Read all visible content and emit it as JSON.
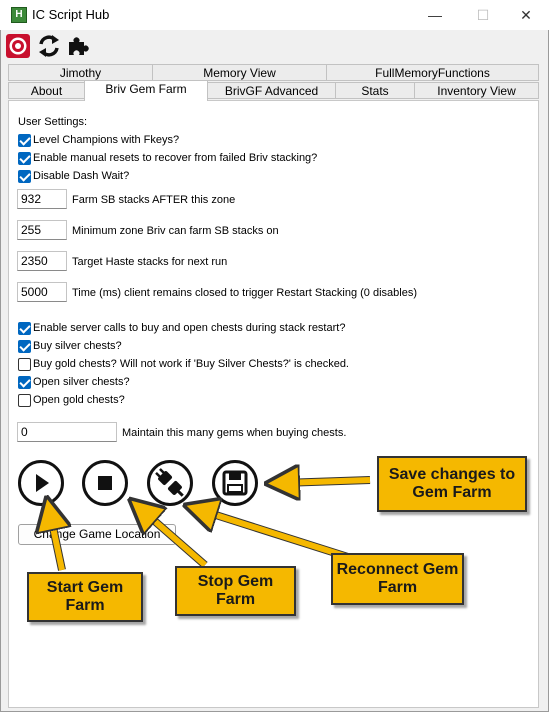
{
  "window": {
    "title": "IC Script Hub",
    "app_icon_letter": "H",
    "minimize_glyph": "—",
    "maximize_glyph": "☐",
    "close_glyph": "✕"
  },
  "toolbar": {
    "icons": [
      "record-icon",
      "refresh-icon",
      "puzzle-icon"
    ]
  },
  "tabs": {
    "row1": [
      "Jimothy",
      "Memory View",
      "FullMemoryFunctions"
    ],
    "row2": [
      "About",
      "Briv Gem Farm",
      "BrivGF Advanced",
      "Stats",
      "Inventory View"
    ],
    "active": "Briv Gem Farm"
  },
  "settings": {
    "header": "User Settings:",
    "level_champions": {
      "label": "Level Champions with Fkeys?",
      "checked": true
    },
    "manual_resets": {
      "label": "Enable manual resets to recover from failed Briv stacking?",
      "checked": true
    },
    "disable_dash": {
      "label": "Disable Dash Wait?",
      "checked": true
    },
    "farm_sb_zone": {
      "value": "932",
      "label": "Farm SB stacks AFTER this zone"
    },
    "min_zone": {
      "value": "255",
      "label": "Minimum zone Briv can farm SB stacks on"
    },
    "target_haste": {
      "value": "2350",
      "label": "Target Haste stacks for next run"
    },
    "restart_time": {
      "value": "5000",
      "label": "Time (ms) client remains closed to trigger Restart Stacking (0 disables)"
    },
    "server_calls": {
      "label": "Enable server calls to buy and open chests during stack restart?",
      "checked": true
    },
    "buy_silver": {
      "label": "Buy silver chests?",
      "checked": true
    },
    "buy_gold": {
      "label": "Buy gold chests? Will not work if 'Buy Silver Chests?' is checked.",
      "checked": false
    },
    "open_silver": {
      "label": "Open silver chests?",
      "checked": true
    },
    "open_gold": {
      "label": "Open gold chests?",
      "checked": false
    },
    "maintain_gems": {
      "value": "0",
      "label": "Maintain this many gems when buying chests."
    }
  },
  "controls": {
    "change_location_label": "Change Game Location"
  },
  "callouts": {
    "save": "Save changes to Gem Farm",
    "start": "Start Gem Farm",
    "stop": "Stop Gem Farm",
    "reconnect": "Reconnect Gem Farm"
  },
  "colors": {
    "callout_fill": "#f5b800",
    "checkbox_accent": "#0067c0",
    "record_red": "#c8102e"
  }
}
